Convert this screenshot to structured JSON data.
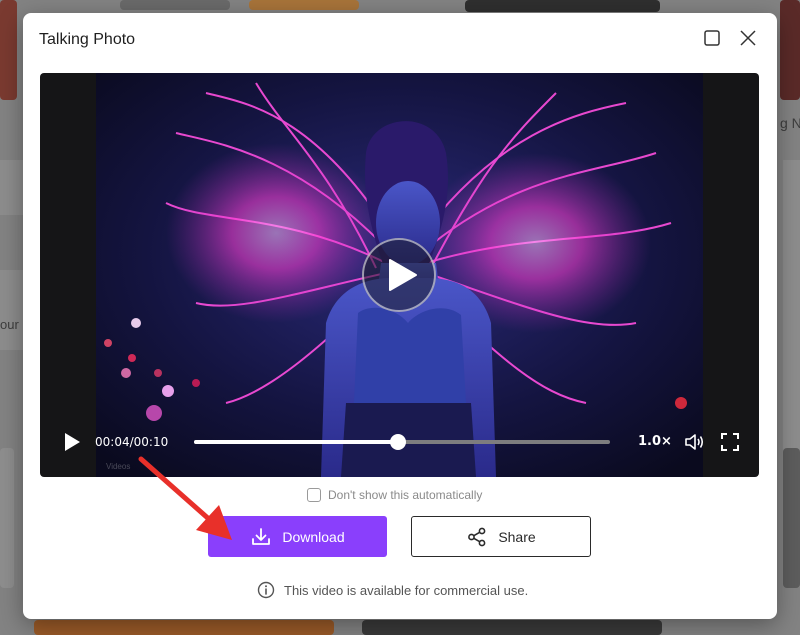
{
  "background": {
    "partial_text_right": "g N",
    "partial_text_left": "our"
  },
  "modal": {
    "title": "Talking Photo",
    "maximize_icon": "maximize-icon",
    "close_icon": "close-icon"
  },
  "player": {
    "current_time": "00:04",
    "duration": "00:10",
    "time_display": "00:04/00:10",
    "progress": 0.49,
    "speed": "1.0×",
    "ghost_label": "Videos",
    "play_icon": "play-icon",
    "volume_icon": "volume-icon",
    "fullscreen_icon": "fullscreen-icon"
  },
  "checkbox": {
    "label": "Don't show this automatically",
    "checked": false
  },
  "actions": {
    "download_label": "Download",
    "share_label": "Share",
    "download_icon": "download-icon",
    "share_icon": "share-icon"
  },
  "notice": {
    "text": "This video is available for commercial use.",
    "icon": "info-icon"
  },
  "colors": {
    "accent": "#8a3ffc",
    "annotation": "#e8302a"
  }
}
